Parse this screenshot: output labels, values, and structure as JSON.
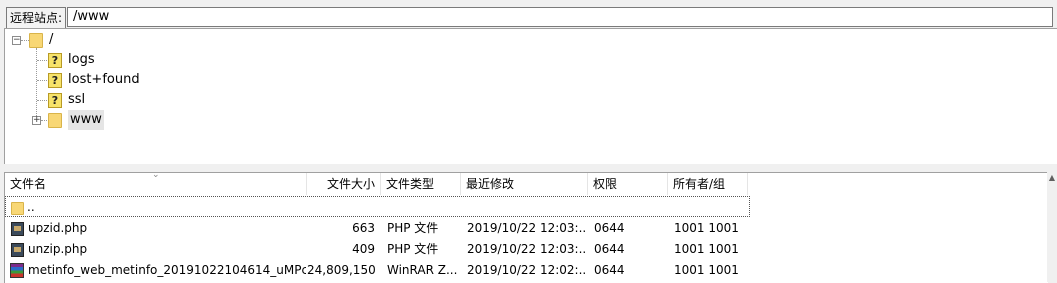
{
  "remote_site": {
    "label": "远程站点:",
    "path_value": "/www"
  },
  "tree": {
    "root": {
      "label": "/",
      "expander": "−"
    },
    "items": [
      {
        "label": "logs",
        "icon": "unknown-folder-icon"
      },
      {
        "label": "lost+found",
        "icon": "unknown-folder-icon"
      },
      {
        "label": "ssl",
        "icon": "unknown-folder-icon"
      },
      {
        "label": "www",
        "icon": "folder-icon",
        "expander": "+",
        "selected": true
      }
    ]
  },
  "file_list": {
    "columns": [
      "文件名",
      "文件大小",
      "文件类型",
      "最近修改",
      "权限",
      "所有者/组"
    ],
    "sort_indicator": "⌄",
    "parent_row": {
      "name": ".."
    },
    "rows": [
      {
        "name": "upzid.php",
        "size": "663",
        "type": "PHP 文件",
        "modified": "2019/10/22 12:03:...",
        "perms": "0644",
        "owner": "1001 1001",
        "icon": "php-file-icon"
      },
      {
        "name": "unzip.php",
        "size": "409",
        "type": "PHP 文件",
        "modified": "2019/10/22 12:03:...",
        "perms": "0644",
        "owner": "1001 1001",
        "icon": "php-file-icon"
      },
      {
        "name": "metinfo_web_metinfo_20191022104614_uMPc...",
        "size": "24,809,150",
        "type": "WinRAR Z...",
        "modified": "2019/10/22 12:02:...",
        "perms": "0644",
        "owner": "1001 1001",
        "icon": "rar-archive-icon"
      }
    ]
  },
  "colors": {
    "folder": "#f8d775",
    "background": "#f0f0f0",
    "pane": "#ffffff"
  }
}
